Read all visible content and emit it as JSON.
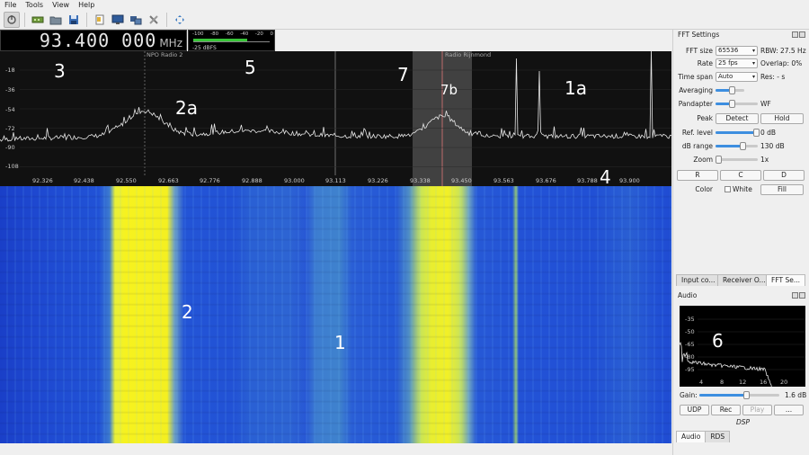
{
  "menu": [
    "File",
    "Tools",
    "View",
    "Help"
  ],
  "toolbar": {
    "icons": [
      "power-icon",
      "hardware-icon",
      "open-icon",
      "save-icon",
      "document-icon",
      "screen-icon",
      "network-icon",
      "tools-icon",
      "fullscreen-icon"
    ]
  },
  "frequency": {
    "digits": "93.400 000",
    "unit": "MHz"
  },
  "meter": {
    "scale": [
      "-100",
      "-80",
      "-60",
      "-40",
      "-20",
      "0"
    ],
    "value": "-25 dBFS",
    "level": 0.75
  },
  "plotter": {
    "stations": [
      "NPO Radio 2",
      "Radio Rijnmond"
    ],
    "y_labels": [
      "-18",
      "-36",
      "-54",
      "-72",
      "-90",
      "-108"
    ],
    "x_labels": [
      "92.326",
      "92.438",
      "92.550",
      "92.663",
      "92.776",
      "92.888",
      "93.000",
      "93.113",
      "93.226",
      "93.338",
      "93.450",
      "93.563",
      "93.676",
      "93.788",
      "93.900"
    ]
  },
  "annotations": {
    "a3": "3",
    "a5": "5",
    "a7": "7",
    "a7b": "7b",
    "a2a": "2a",
    "a1a": "1a",
    "a4": "4",
    "a2": "2",
    "a1": "1",
    "a6": "6"
  },
  "fft_settings": {
    "title": "FFT Settings",
    "fft_size_label": "FFT size",
    "fft_size_value": "65536",
    "rbw": "RBW: 27.5 Hz",
    "rate_label": "Rate",
    "rate_value": "25 fps",
    "overlap": "Overlap: 0%",
    "timespan_label": "Time span",
    "timespan_value": "Auto",
    "res": "Res: - s",
    "averaging_label": "Averaging",
    "averaging_level": 0.6,
    "pandapter_label": "Pandapter",
    "pandapter_level": 0.4,
    "wf_label": "WF",
    "peak_label": "Peak",
    "detect_label": "Detect",
    "hold_label": "Hold",
    "ref_label": "Ref. level",
    "ref_level": 0.97,
    "ref_value": "0 dB",
    "range_label": "dB range",
    "range_level": 0.65,
    "range_value": "130 dB",
    "zoom_label": "Zoom",
    "zoom_level": 0.03,
    "zoom_value": "1x",
    "r_label": "R",
    "c_label": "C",
    "d_label": "D",
    "color_label": "Color",
    "white_label": "White",
    "fill_label": "Fill"
  },
  "dock_tabs": [
    "Input co...",
    "Receiver O...",
    "FFT Se..."
  ],
  "audio": {
    "title": "Audio",
    "y_labels": [
      "-35",
      "-50",
      "-65",
      "-80",
      "-95"
    ],
    "x_labels": [
      "4",
      "8",
      "12",
      "16",
      "20"
    ],
    "gain_label": "Gain:",
    "gain_level": 0.6,
    "gain_value": "1.6 dB",
    "udp_label": "UDP",
    "rec_label": "Rec",
    "play_label": "Play",
    "more_label": "...",
    "dsp_label": "DSP"
  },
  "bottom_tabs": [
    "Audio",
    "RDS"
  ]
}
